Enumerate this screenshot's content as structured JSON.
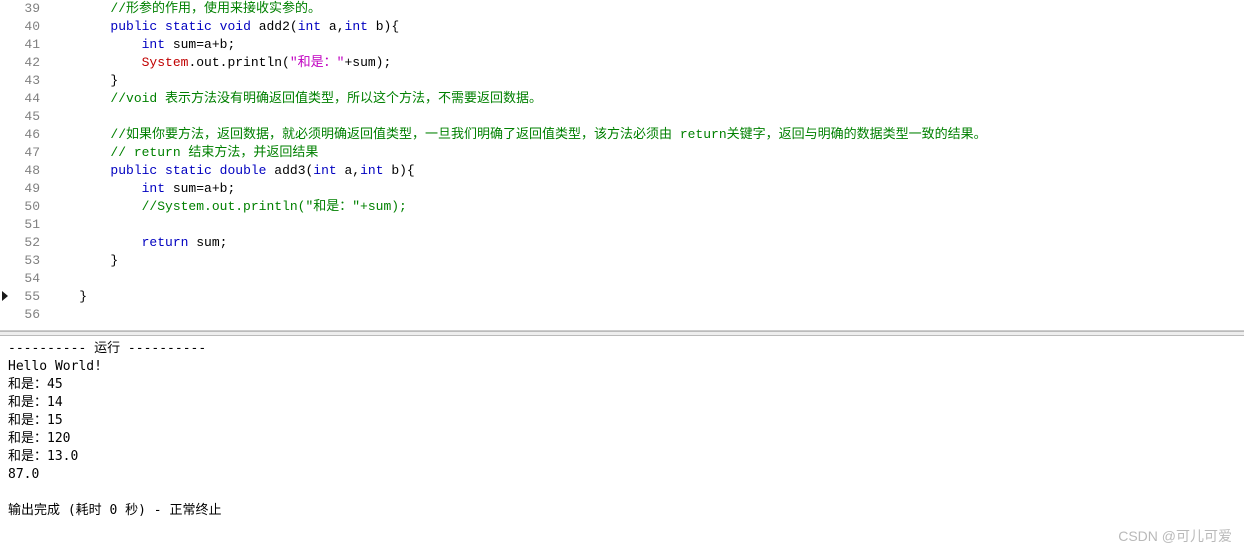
{
  "editor": {
    "lines": [
      {
        "num": 39,
        "indent": "        ",
        "tokens": [
          {
            "t": "//形参的作用，使用来接收实参的。",
            "c": "comment"
          }
        ]
      },
      {
        "num": 40,
        "indent": "        ",
        "tokens": [
          {
            "t": "public",
            "c": "kw"
          },
          {
            "t": " "
          },
          {
            "t": "static",
            "c": "kw"
          },
          {
            "t": " "
          },
          {
            "t": "void",
            "c": "kw"
          },
          {
            "t": " add2("
          },
          {
            "t": "int",
            "c": "kw"
          },
          {
            "t": " a,"
          },
          {
            "t": "int",
            "c": "kw"
          },
          {
            "t": " b){"
          }
        ]
      },
      {
        "num": 41,
        "indent": "            ",
        "tokens": [
          {
            "t": "int",
            "c": "kw"
          },
          {
            "t": " sum=a+b;"
          }
        ]
      },
      {
        "num": 42,
        "indent": "            ",
        "tokens": [
          {
            "t": "System",
            "c": "cls"
          },
          {
            "t": ".out.println("
          },
          {
            "t": "\"和是：\"",
            "c": "string"
          },
          {
            "t": "+sum);"
          }
        ]
      },
      {
        "num": 43,
        "indent": "        ",
        "tokens": [
          {
            "t": "}"
          }
        ]
      },
      {
        "num": 44,
        "indent": "        ",
        "tokens": [
          {
            "t": "//void 表示方法没有明确返回值类型，所以这个方法，不需要返回数据。",
            "c": "comment"
          }
        ]
      },
      {
        "num": 45,
        "indent": "",
        "tokens": []
      },
      {
        "num": 46,
        "indent": "        ",
        "tokens": [
          {
            "t": "//如果你要方法，返回数据，就必须明确返回值类型，一旦我们明确了返回值类型，该方法必须由 return关键字，返回与明确的数据类型一致的结果。",
            "c": "comment"
          }
        ]
      },
      {
        "num": 47,
        "indent": "        ",
        "tokens": [
          {
            "t": "// return 结束方法，并返回结果",
            "c": "comment"
          }
        ]
      },
      {
        "num": 48,
        "indent": "        ",
        "tokens": [
          {
            "t": "public",
            "c": "kw"
          },
          {
            "t": " "
          },
          {
            "t": "static",
            "c": "kw"
          },
          {
            "t": " "
          },
          {
            "t": "double",
            "c": "kw"
          },
          {
            "t": " add3("
          },
          {
            "t": "int",
            "c": "kw"
          },
          {
            "t": " a,"
          },
          {
            "t": "int",
            "c": "kw"
          },
          {
            "t": " b){"
          }
        ]
      },
      {
        "num": 49,
        "indent": "            ",
        "tokens": [
          {
            "t": "int",
            "c": "kw"
          },
          {
            "t": " sum=a+b;"
          }
        ]
      },
      {
        "num": 50,
        "indent": "            ",
        "tokens": [
          {
            "t": "//System.out.println(\"和是：\"+sum);",
            "c": "comment"
          }
        ]
      },
      {
        "num": 51,
        "indent": "",
        "tokens": []
      },
      {
        "num": 52,
        "indent": "            ",
        "tokens": [
          {
            "t": "return",
            "c": "kw"
          },
          {
            "t": " sum;"
          }
        ]
      },
      {
        "num": 53,
        "indent": "        ",
        "tokens": [
          {
            "t": "}"
          }
        ]
      },
      {
        "num": 54,
        "indent": "",
        "tokens": []
      },
      {
        "num": 55,
        "indent": "    ",
        "marker": true,
        "tokens": [
          {
            "t": "}"
          }
        ]
      },
      {
        "num": 56,
        "indent": "",
        "tokens": []
      }
    ]
  },
  "console": {
    "lines": [
      "---------- 运行 ----------",
      "Hello World!",
      "和是：45",
      "和是：14",
      "和是：15",
      "和是：120",
      "和是：13.0",
      "87.0",
      "",
      "输出完成 (耗时 0 秒) - 正常终止"
    ]
  },
  "watermark": "CSDN @可儿可爱"
}
